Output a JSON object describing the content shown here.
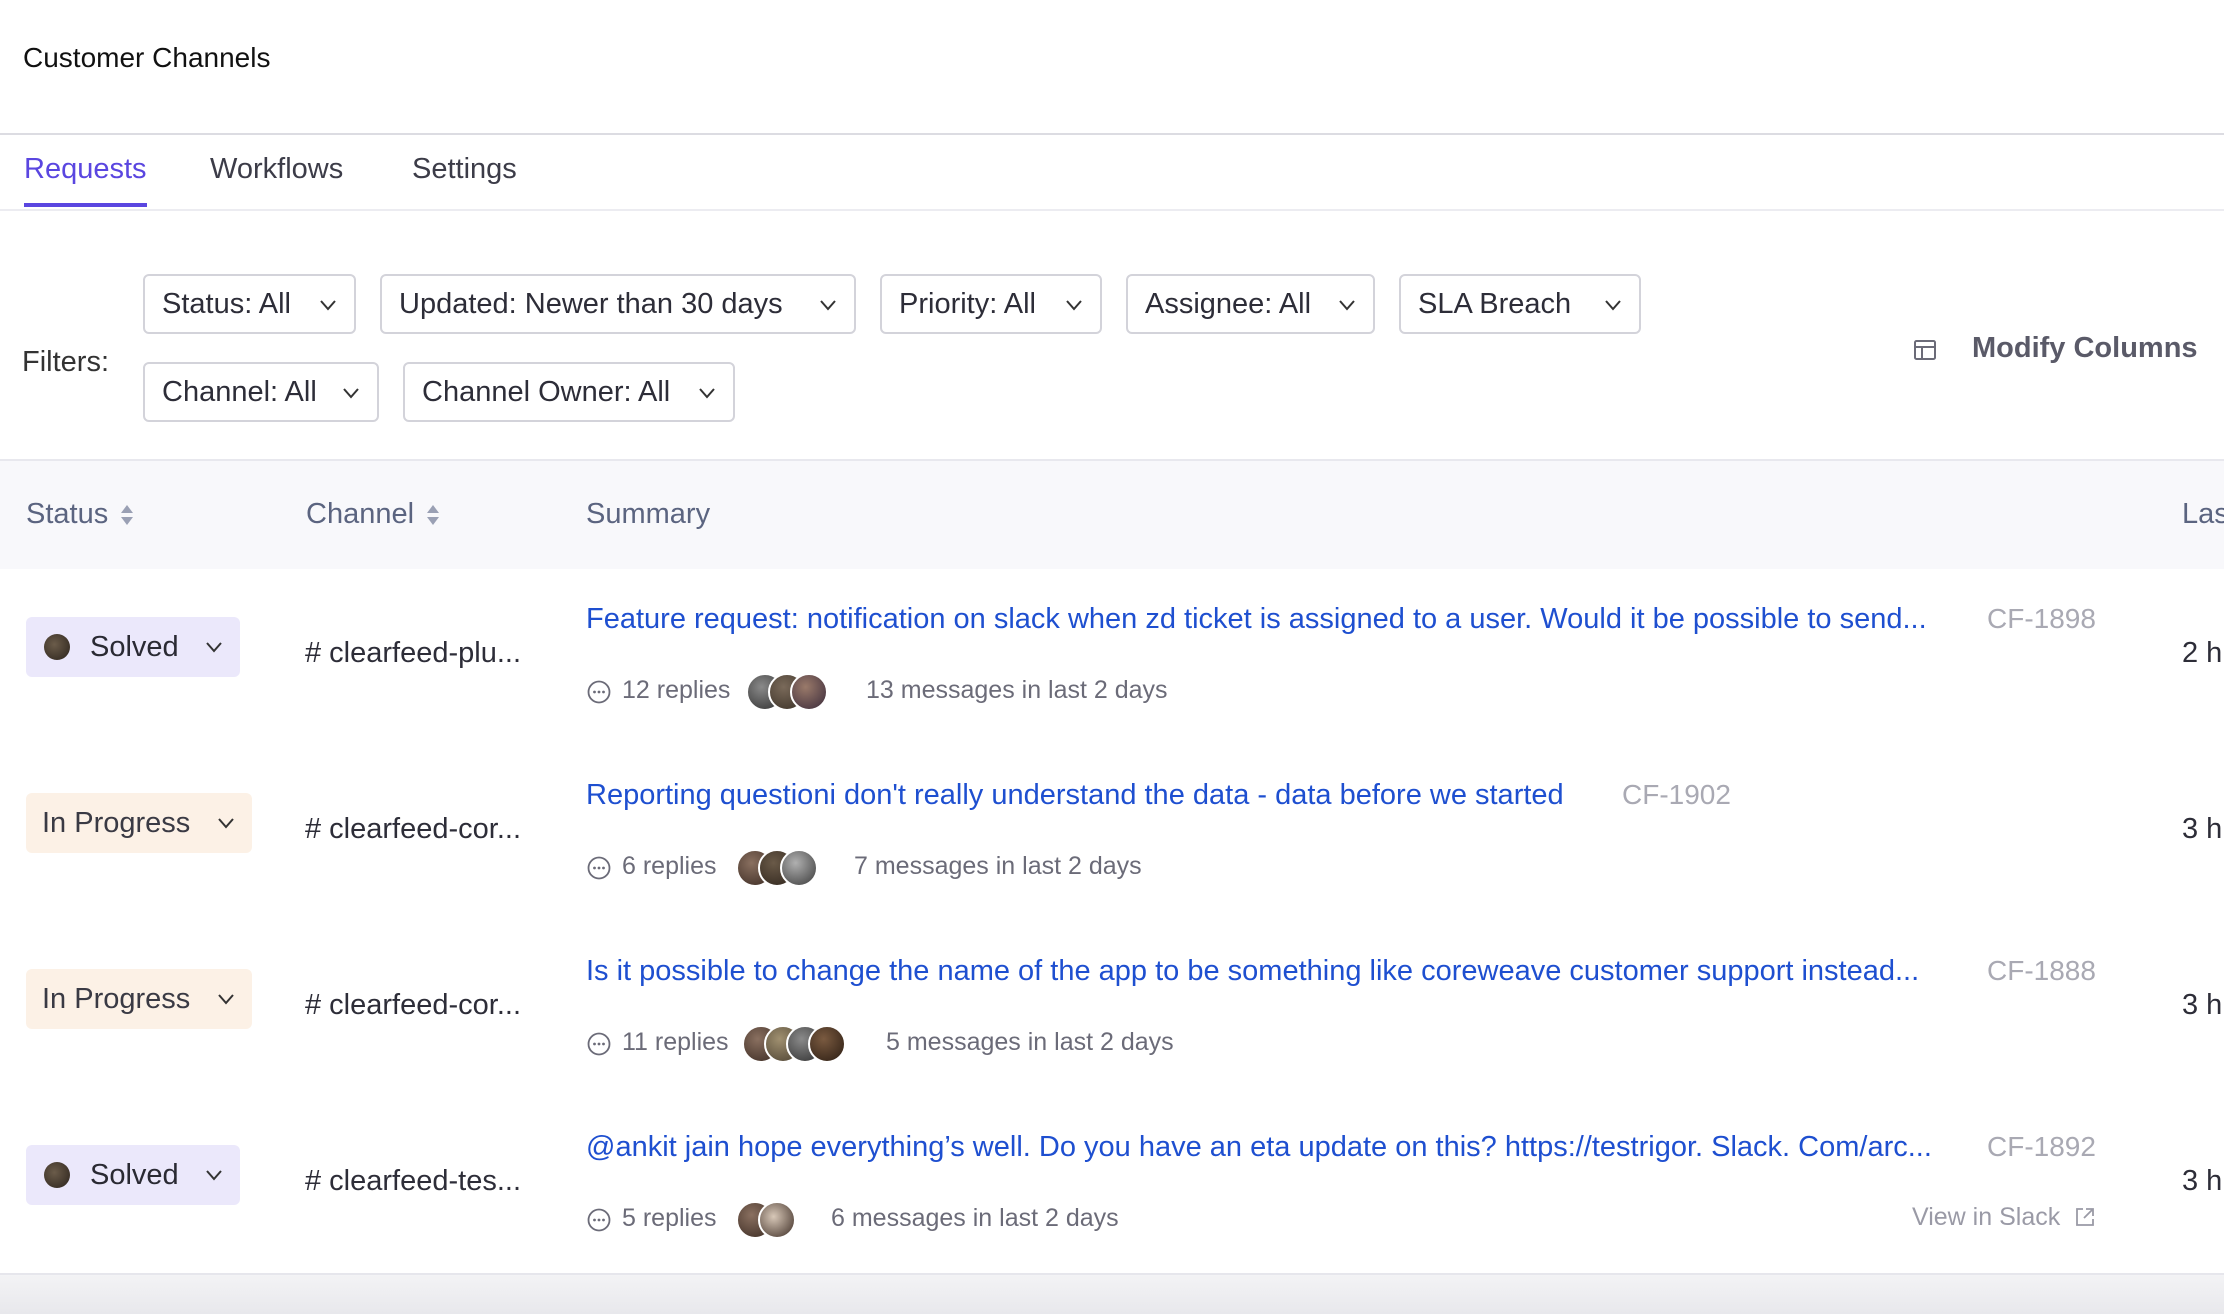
{
  "app": {
    "title": "Customer Channels"
  },
  "tabs": [
    {
      "label": "Requests",
      "active": true
    },
    {
      "label": "Workflows",
      "active": false
    },
    {
      "label": "Settings",
      "active": false
    }
  ],
  "filters": {
    "label": "Filters:",
    "status": "Status: All",
    "updated": "Updated: Newer than 30 days",
    "priority": "Priority: All",
    "assignee": "Assignee: All",
    "sla": "SLA Breach",
    "channel": "Channel: All",
    "channel_owner": "Channel Owner: All",
    "modify_columns": "Modify Columns",
    "icons": {
      "dropdown": "chevron-down-icon",
      "modify_columns": "table-columns-icon"
    }
  },
  "table": {
    "columns": {
      "status": "Status",
      "channel": "Channel",
      "summary": "Summary",
      "last": "Las"
    },
    "rows": [
      {
        "status": "Solved",
        "status_type": "solved",
        "channel": "# clearfeed-plu...",
        "summary": "Feature request: notification on slack when zd ticket is assigned to a user. Would it be possible to send...",
        "id": "CF-1898",
        "replies": "12 replies",
        "messages": "13 messages in last 2 days",
        "last": "2 h",
        "avatar_count": 3
      },
      {
        "status": "In Progress",
        "status_type": "inprog",
        "channel": "# clearfeed-cor...",
        "summary": "Reporting questioni don't really understand the data - data before we started",
        "id": "CF-1902",
        "replies": "6 replies",
        "messages": "7 messages in last 2 days",
        "last": "3 h",
        "avatar_count": 3
      },
      {
        "status": "In Progress",
        "status_type": "inprog",
        "channel": "# clearfeed-cor...",
        "summary": "Is it possible to change the name of the app to be something like coreweave customer support instead...",
        "id": "CF-1888",
        "replies": "11 replies",
        "messages": "5 messages in last 2 days",
        "last": "3 h",
        "avatar_count": 4
      },
      {
        "status": "Solved",
        "status_type": "solved",
        "channel": "# clearfeed-tes...",
        "summary": "@ankit jain hope everything’s well. Do you have an eta update on this? https://testrigor. Slack. Com/arc...",
        "id": "CF-1892",
        "replies": "5 replies",
        "messages": "6 messages in last 2 days",
        "last": "3 h",
        "avatar_count": 2,
        "view_in_slack": "View in Slack"
      }
    ]
  },
  "colors": {
    "accent": "#5a46e0",
    "link": "#1e4fd0",
    "solved_bg": "#ebe8fb",
    "in_progress_bg": "#fcf1e6"
  }
}
